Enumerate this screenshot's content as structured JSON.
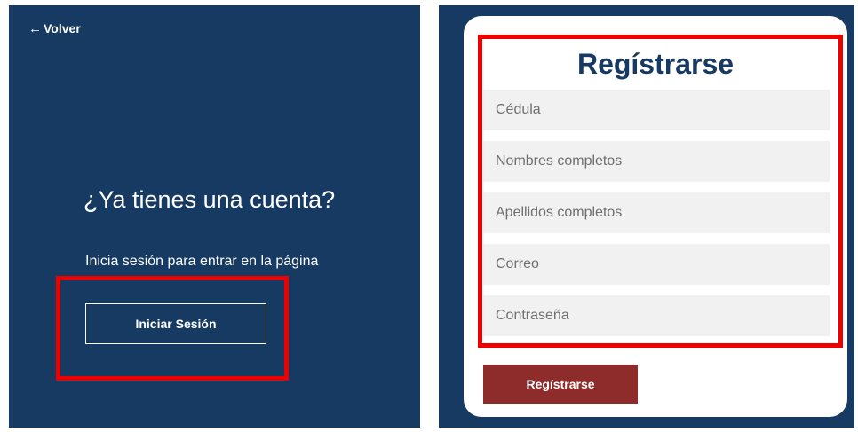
{
  "colors": {
    "panel_bg": "#173a62",
    "card_bg": "#ffffff",
    "field_bg": "#f1f1f1",
    "submit_bg": "#8e2b2b",
    "highlight": "#ee0000"
  },
  "left": {
    "back_icon": "left-arrow-icon",
    "back_glyph": "←",
    "back_label": "Volver",
    "title": "¿Ya tienes una cuenta?",
    "subtitle": "Inicia sesión para entrar en la página",
    "login_button": "Iniciar Sesión"
  },
  "register": {
    "title": "Regístrarse",
    "fields": [
      {
        "placeholder": "Cédula",
        "value": ""
      },
      {
        "placeholder": "Nombres completos",
        "value": ""
      },
      {
        "placeholder": "Apellidos completos",
        "value": ""
      },
      {
        "placeholder": "Correo",
        "value": ""
      },
      {
        "placeholder": "Contraseña",
        "value": ""
      }
    ],
    "submit_button": "Regístrarse"
  }
}
